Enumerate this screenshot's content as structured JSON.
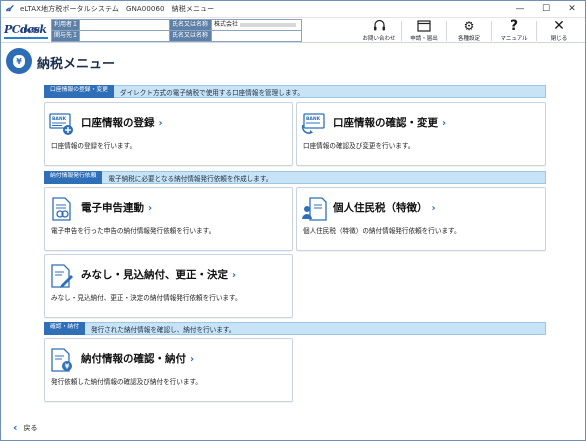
{
  "window": {
    "title": "eLTAX地方税ポータルシステム　GNA00060　納税メニュー",
    "controls": [
      "—",
      "☐",
      "✕"
    ]
  },
  "header": {
    "logo_main": "PCdesk",
    "logo_sub": "(DL版)",
    "info": {
      "user_id_label": "利用者ＩＤ",
      "user_id_value": "",
      "name1_label": "氏名又は名称",
      "name1_value": "株式会社",
      "proxy_id_label": "関与先ＩＤ",
      "proxy_id_value": "",
      "name2_label": "氏名又は名称",
      "name2_value": ""
    },
    "toolbar": [
      {
        "icon": "headset-icon",
        "glyph": "🎧",
        "label": "お問い合わせ"
      },
      {
        "icon": "window-icon",
        "glyph": "▭",
        "label": "申請・届出"
      },
      {
        "icon": "gear-icon",
        "glyph": "⚙",
        "label": "各種設定"
      },
      {
        "icon": "question-icon",
        "glyph": "?",
        "label": "マニュアル"
      },
      {
        "icon": "close-icon",
        "glyph": "✕",
        "label": "閉じる"
      }
    ]
  },
  "page": {
    "title": "納税メニュー",
    "yen": "¥"
  },
  "sections": [
    {
      "tag": "口座情報の登録・変更",
      "desc": "ダイレクト方式の電子納税で使用する口座情報を管理します。",
      "cards": [
        {
          "title": "口座情報の登録",
          "desc": "口座情報の登録を行います。",
          "icon": "bank-add-icon"
        },
        {
          "title": "口座情報の確認・変更",
          "desc": "口座情報の確認及び変更を行います。",
          "icon": "bank-refresh-icon"
        }
      ]
    },
    {
      "tag": "納付情報発行依頼",
      "desc": "電子納税に必要となる納付情報発行依頼を作成します。",
      "cards": [
        {
          "title": "電子申告連動",
          "desc": "電子申告を行った申告の納付情報発行依頼を行います。",
          "icon": "document-link-icon"
        },
        {
          "title": "個人住民税（特徴）",
          "desc": "個人住民税（特徴）の納付情報発行依頼を行います。",
          "icon": "person-document-icon"
        },
        {
          "title": "みなし・見込納付、更正・決定",
          "desc": "みなし・見込納付、更正・決定の納付情報発行依頼を行います。",
          "icon": "document-edit-icon"
        }
      ]
    },
    {
      "tag": "確認・納付",
      "desc": "発行された納付情報を確認し、納付を行います。",
      "cards": [
        {
          "title": "納付情報の確認・納付",
          "desc": "発行依頼した納付情報の確認及び納付を行います。",
          "icon": "document-yen-icon"
        }
      ]
    }
  ],
  "footer": {
    "back_label": "戻る"
  },
  "colors": {
    "accent": "#2f6fb8",
    "section_band": "#c8e3f5",
    "label_bg": "#5e7fa6"
  }
}
